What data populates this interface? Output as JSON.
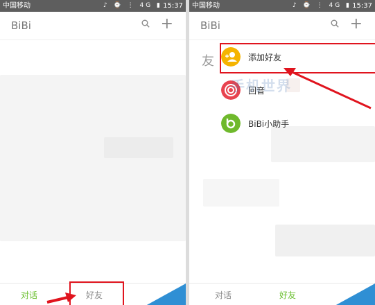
{
  "status_bar": {
    "carrier_left": "中国移动",
    "carrier_right": "中国移动",
    "icons": "♪ ⌚ ⋮ 4G ▮",
    "time": "15:37"
  },
  "app": {
    "title": "BiBi",
    "search_icon": "search-icon",
    "add_label": "+"
  },
  "tabs": [
    {
      "label": "对话"
    },
    {
      "label": "好友"
    }
  ],
  "left_screen": {
    "active_tab": "对话"
  },
  "right_screen": {
    "active_tab": "好友",
    "section_letter": "友",
    "watermark": "手机世界",
    "friends": [
      {
        "label": "添加好友",
        "icon": "add-friend-icon",
        "color": "#f5b400"
      },
      {
        "label": "回音",
        "icon": "echo-icon",
        "color": "#e8434f"
      },
      {
        "label": "BiBi小助手",
        "icon": "bibi-helper-icon",
        "color": "#6fb92c"
      }
    ]
  },
  "colors": {
    "accent": "#6abf2e",
    "highlight": "#e0141e",
    "status_bar": "#5e5e5e"
  }
}
